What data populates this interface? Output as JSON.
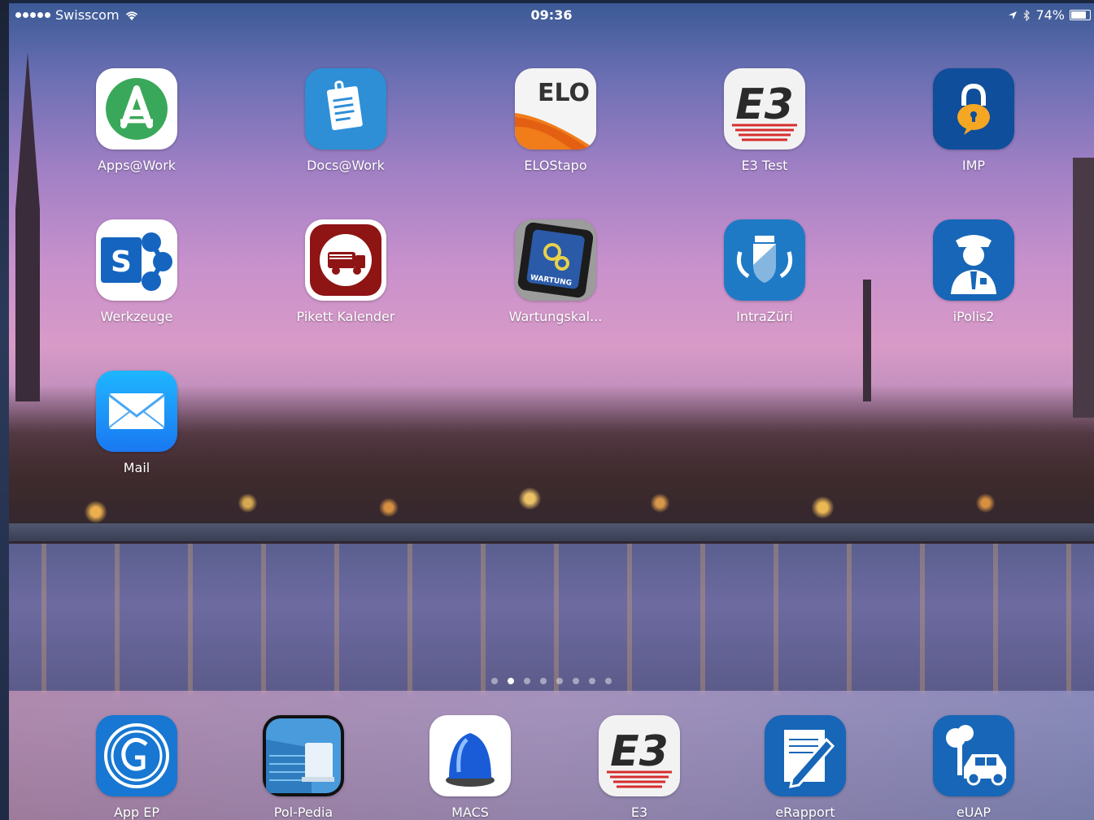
{
  "status_bar": {
    "carrier": "Swisscom",
    "time": "09:36",
    "battery_percent": "74%",
    "battery_level": 0.74,
    "icons": [
      "signal-dots-icon",
      "wifi-icon",
      "location-arrow-icon",
      "bluetooth-icon",
      "battery-icon"
    ]
  },
  "home": {
    "apps": [
      {
        "label": "Apps@Work",
        "icon": "apps-at-work-icon"
      },
      {
        "label": "Docs@Work",
        "icon": "docs-at-work-icon"
      },
      {
        "label": "ELOStapo",
        "icon": "elo-icon",
        "icon_text": "ELO"
      },
      {
        "label": "E3 Test",
        "icon": "e3-test-icon",
        "icon_text": "E3"
      },
      {
        "label": "IMP",
        "icon": "imp-lock-icon"
      },
      {
        "label": "Werkzeuge",
        "icon": "sharepoint-icon",
        "icon_text": "S"
      },
      {
        "label": "Pikett Kalender",
        "icon": "fire-truck-icon"
      },
      {
        "label": "Wartungskal...",
        "icon": "wartung-gears-icon",
        "icon_text": "WARTUNG"
      },
      {
        "label": "IntraZüri",
        "icon": "zurich-coat-of-arms-icon"
      },
      {
        "label": "iPolis2",
        "icon": "police-officer-icon"
      },
      {
        "label": "Mail",
        "icon": "mail-envelope-icon"
      }
    ]
  },
  "page_indicator": {
    "count": 8,
    "active_index": 1
  },
  "dock": {
    "apps": [
      {
        "label": "App EP",
        "icon": "app-ep-icon"
      },
      {
        "label": "Pol-Pedia",
        "icon": "pol-pedia-book-icon"
      },
      {
        "label": "MACS",
        "icon": "blue-siren-icon"
      },
      {
        "label": "E3",
        "icon": "e3-icon",
        "icon_text": "E3"
      },
      {
        "label": "eRapport",
        "icon": "erapport-pen-icon"
      },
      {
        "label": "eUAP",
        "icon": "euap-car-crash-icon"
      }
    ]
  }
}
